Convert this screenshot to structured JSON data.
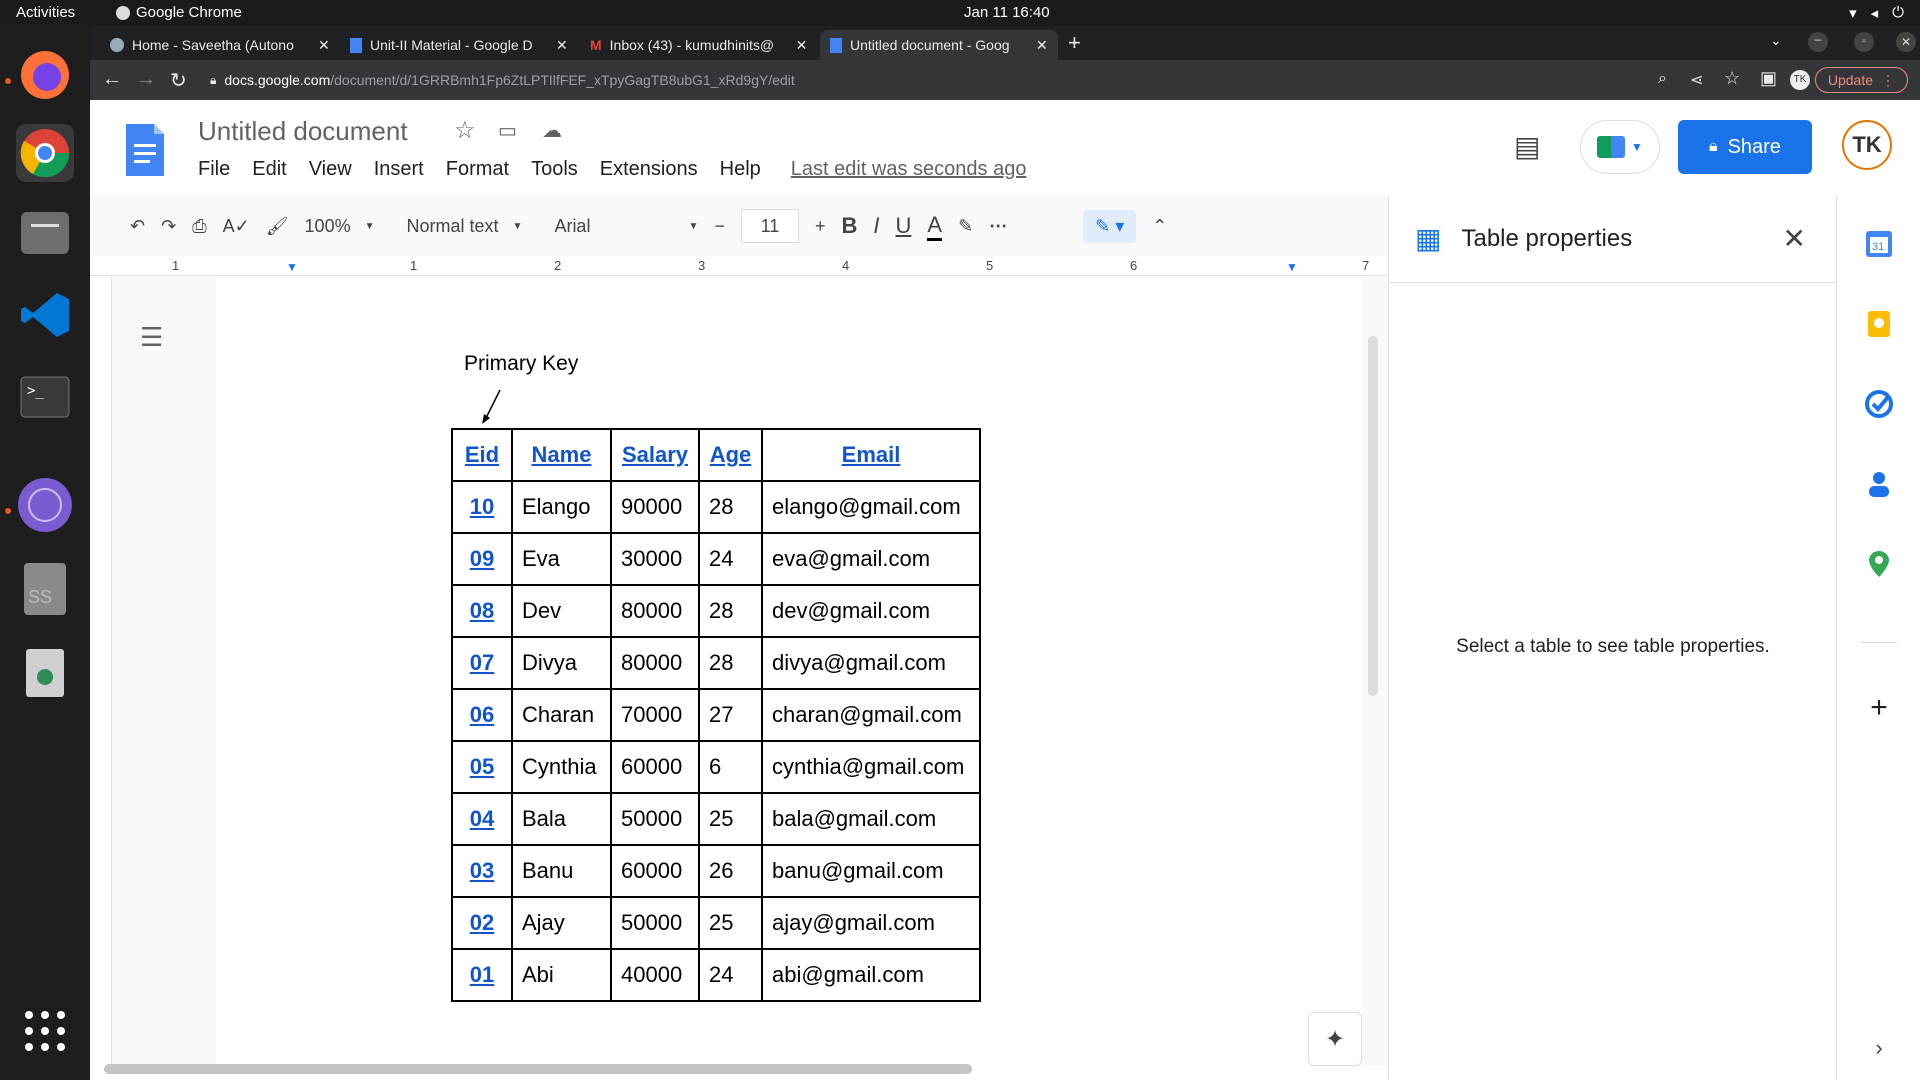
{
  "gnome": {
    "activities": "Activities",
    "app": "Google Chrome",
    "clock": "Jan 11  16:40"
  },
  "tabs": [
    {
      "title": "Home - Saveetha (Autono",
      "icon": "moodle-icon"
    },
    {
      "title": "Unit-II Material - Google D",
      "icon": "docs-icon"
    },
    {
      "title": "Inbox (43) - kumudhinits@",
      "icon": "gmail-icon"
    },
    {
      "title": "Untitled document - Goog",
      "icon": "docs-icon"
    }
  ],
  "address": {
    "domain": "docs.google.com",
    "path": "/document/d/1GRRBmh1Fp6ZtLPTIlfFEF_xTpyGagTB8ubG1_xRd9gY/edit",
    "update": "Update"
  },
  "doc": {
    "title": "Untitled document",
    "last_edit": "Last edit was seconds ago",
    "share": "Share",
    "avatar": "TK"
  },
  "menu": [
    "File",
    "Edit",
    "View",
    "Insert",
    "Format",
    "Tools",
    "Extensions",
    "Help"
  ],
  "toolbar": {
    "zoom": "100%",
    "style": "Normal text",
    "font": "Arial",
    "size": "11"
  },
  "ruler": [
    "1",
    "1",
    "2",
    "3",
    "4",
    "5",
    "6",
    "7"
  ],
  "annotation": "Primary Key",
  "table": {
    "headers": [
      "Eid",
      "Name",
      "Salary",
      "Age",
      "Email"
    ],
    "rows": [
      [
        "10",
        "Elango",
        "90000",
        "28",
        "elango@gmail.com"
      ],
      [
        "09",
        "Eva",
        "30000",
        "24",
        "eva@gmail.com"
      ],
      [
        "08",
        "Dev",
        "80000",
        "28",
        "dev@gmail.com"
      ],
      [
        "07",
        "Divya",
        "80000",
        "28",
        "divya@gmail.com"
      ],
      [
        "06",
        "Charan",
        "70000",
        "27",
        "charan@gmail.com"
      ],
      [
        "05",
        "Cynthia",
        "60000",
        "6",
        "cynthia@gmail.com"
      ],
      [
        "04",
        "Bala",
        "50000",
        "25",
        "bala@gmail.com"
      ],
      [
        "03",
        "Banu",
        "60000",
        "26",
        "banu@gmail.com"
      ],
      [
        "02",
        "Ajay",
        "50000",
        "25",
        "ajay@gmail.com"
      ],
      [
        "01",
        "Abi",
        "40000",
        "24",
        "abi@gmail.com"
      ]
    ]
  },
  "panel": {
    "title": "Table properties",
    "message": "Select a table to see table properties."
  },
  "colors": {
    "accent": "#1a73e8",
    "link": "#1155cc"
  }
}
